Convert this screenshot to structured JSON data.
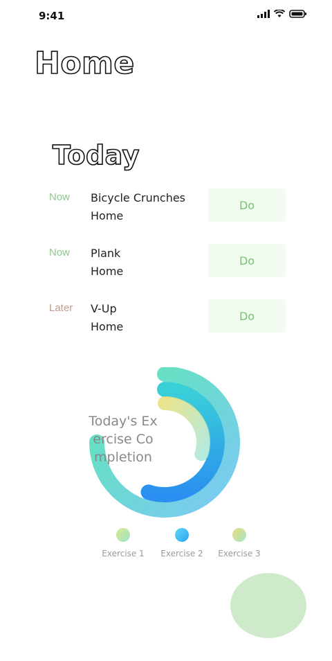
{
  "status": {
    "time": "9:41"
  },
  "header": {
    "title": "Home"
  },
  "section": {
    "title": "Today"
  },
  "exercises": [
    {
      "when": "Now",
      "name": "Bicycle Crunches",
      "location": "Home",
      "action": "Do"
    },
    {
      "when": "Now",
      "name": "Plank",
      "location": "Home",
      "action": "Do"
    },
    {
      "when": "Later",
      "name": "V-Up",
      "location": "Home",
      "action": "Do"
    }
  ],
  "chart_data": {
    "type": "radial-bar",
    "title": "Today's Exercise Completion",
    "series": [
      {
        "name": "Exercise 1",
        "value": 0.75,
        "color": "#a6e0b0"
      },
      {
        "name": "Exercise 2",
        "value": 0.55,
        "color": "#35b6f2"
      },
      {
        "name": "Exercise 3",
        "value": 0.3,
        "color": "#d6e08a"
      }
    ]
  },
  "legend": {
    "items": [
      {
        "label": "Exercise 1",
        "color": "#a6e0b0"
      },
      {
        "label": "Exercise 2",
        "color": "#35b6f2"
      },
      {
        "label": "Exercise 3",
        "color": "#d6e08a"
      }
    ]
  },
  "fab": {
    "icon": "blank-circle-icon"
  }
}
